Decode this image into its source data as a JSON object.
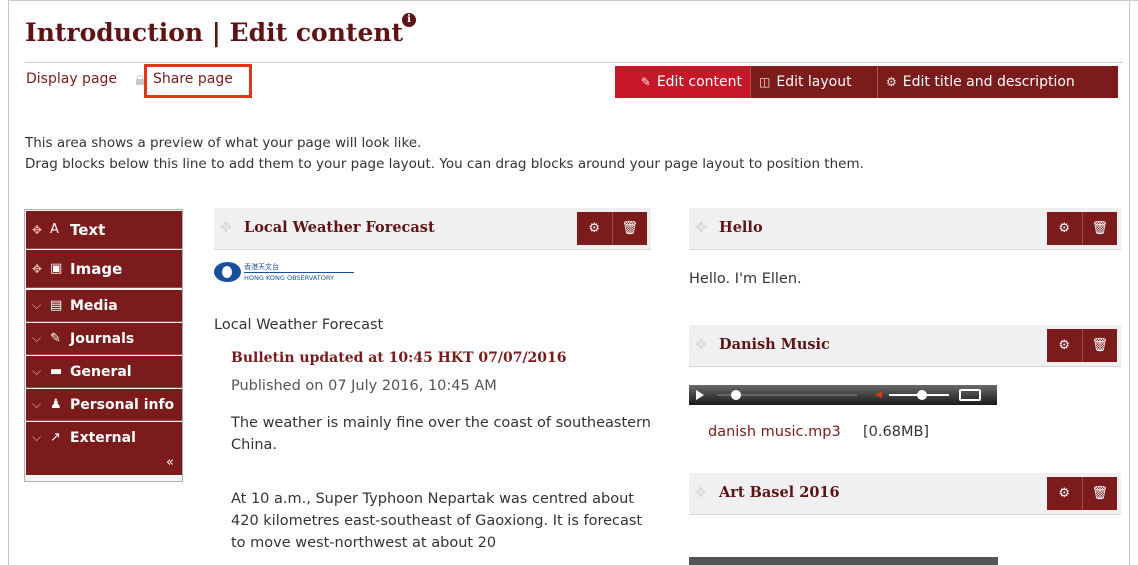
{
  "page": {
    "title": "Introduction | Edit content",
    "info_icon": "info-icon"
  },
  "nav": {
    "display_page": "Display page",
    "share_page": "Share page",
    "highlight_color": "#e53419"
  },
  "edit_tabs": [
    {
      "label": "Edit content",
      "icon": "pencil-icon",
      "active": true
    },
    {
      "label": "Edit layout",
      "icon": "layout-icon",
      "active": false
    },
    {
      "label": "Edit title and description",
      "icon": "gears-icon",
      "active": false
    }
  ],
  "intro": {
    "line1": "This area shows a preview of what your page will look like.",
    "line2": "Drag blocks below this line to add them to your page layout. You can drag blocks around your page layout to position them."
  },
  "toolbox": {
    "items": [
      {
        "label": "Text",
        "icon": "text-icon"
      },
      {
        "label": "Image",
        "icon": "image-icon"
      },
      {
        "label": "Media",
        "icon": "film-icon"
      },
      {
        "label": "Journals",
        "icon": "pencil-icon"
      },
      {
        "label": "General",
        "icon": "briefcase-icon"
      },
      {
        "label": "Personal info",
        "icon": "user-icon"
      },
      {
        "label": "External",
        "icon": "external-link-icon"
      }
    ],
    "collapse": "«"
  },
  "blocks": {
    "weather": {
      "title": "Local Weather Forecast",
      "logo_cn": "香港天文台",
      "logo_en": "HONG KONG OBSERVATORY",
      "subtitle": "Local Weather Forecast",
      "bulletin": "Bulletin updated at 10:45 HKT 07/07/2016",
      "published": "Published on 07 July 2016, 10:45 AM",
      "para1": "The weather is mainly fine over the coast of southeastern China.",
      "para2": "At 10 a.m., Super Typhoon Nepartak was centred about 420 kilometres east-southeast of Gaoxiong. It is forecast to move west-northwest at about 20"
    },
    "hello": {
      "title": "Hello",
      "text": "Hello. I'm Ellen."
    },
    "music": {
      "title": "Danish Music",
      "file": "danish music.mp3",
      "size": "[0.68MB]"
    },
    "art": {
      "title": "Art Basel 2016"
    }
  },
  "colors": {
    "brand": "#7b1b1b",
    "active_tab": "#c7182a",
    "title": "#5e1414"
  }
}
